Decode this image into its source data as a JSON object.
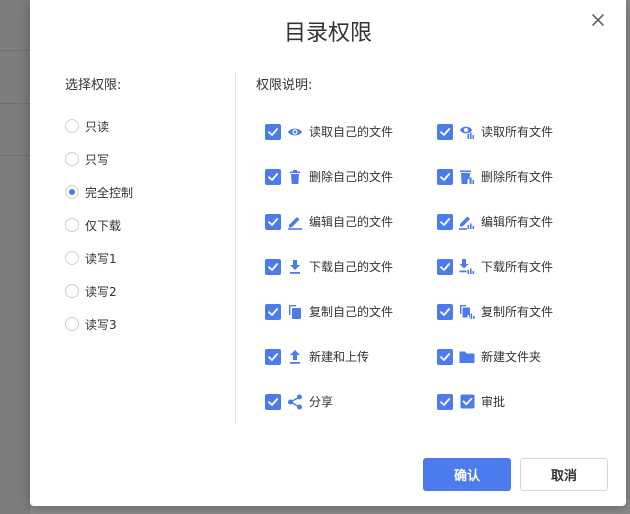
{
  "dialog": {
    "title": "目录权限",
    "left_label": "选择权限:",
    "right_label": "权限说明:",
    "options": [
      {
        "label": "只读",
        "checked": false
      },
      {
        "label": "只写",
        "checked": false
      },
      {
        "label": "完全控制",
        "checked": true
      },
      {
        "label": "仅下载",
        "checked": false
      },
      {
        "label": "读写1",
        "checked": false
      },
      {
        "label": "读写2",
        "checked": false
      },
      {
        "label": "读写3",
        "checked": false
      }
    ],
    "permissions_left": [
      {
        "label": "读取自己的文件",
        "icon": "eye-icon",
        "checked": true
      },
      {
        "label": "删除自己的文件",
        "icon": "trash-icon",
        "checked": true
      },
      {
        "label": "编辑自己的文件",
        "icon": "pencil-icon",
        "checked": true
      },
      {
        "label": "下载自己的文件",
        "icon": "download-icon",
        "checked": true
      },
      {
        "label": "复制自己的文件",
        "icon": "copy-icon",
        "checked": true
      },
      {
        "label": "新建和上传",
        "icon": "upload-icon",
        "checked": true
      },
      {
        "label": "分享",
        "icon": "share-icon",
        "checked": true
      }
    ],
    "permissions_right": [
      {
        "label": "读取所有文件",
        "icon": "read-all-icon",
        "checked": true
      },
      {
        "label": "删除所有文件",
        "icon": "delete-all-icon",
        "checked": true
      },
      {
        "label": "编辑所有文件",
        "icon": "edit-all-icon",
        "checked": true
      },
      {
        "label": "下载所有文件",
        "icon": "download-all-icon",
        "checked": true
      },
      {
        "label": "复制所有文件",
        "icon": "copy-all-icon",
        "checked": true
      },
      {
        "label": "新建文件夹",
        "icon": "folder-icon",
        "checked": true
      },
      {
        "label": "审批",
        "icon": "approve-icon",
        "checked": true
      }
    ],
    "ok_label": "确认",
    "cancel_label": "取消"
  },
  "colors": {
    "accent": "#4b7bec",
    "text": "#333333"
  }
}
